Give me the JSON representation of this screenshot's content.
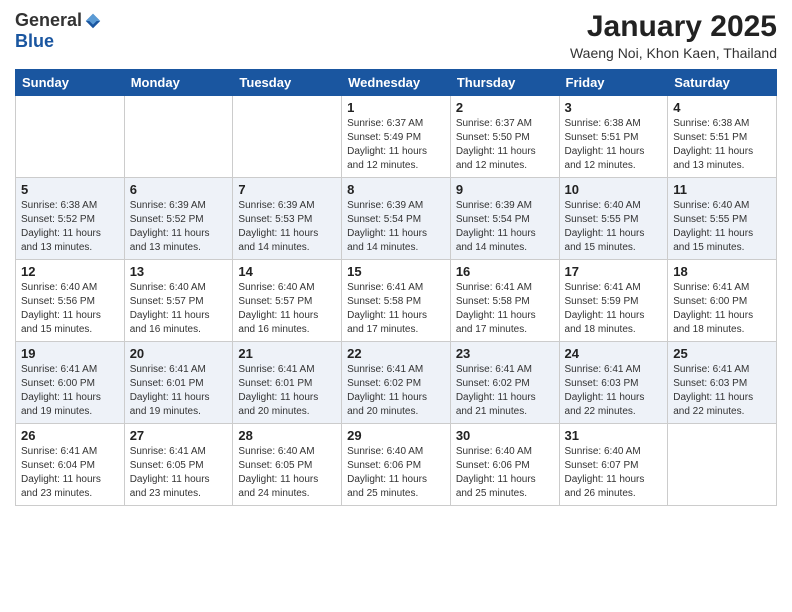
{
  "logo": {
    "general": "General",
    "blue": "Blue"
  },
  "header": {
    "month": "January 2025",
    "location": "Waeng Noi, Khon Kaen, Thailand"
  },
  "weekdays": [
    "Sunday",
    "Monday",
    "Tuesday",
    "Wednesday",
    "Thursday",
    "Friday",
    "Saturday"
  ],
  "weeks": [
    [
      {
        "day": "",
        "info": ""
      },
      {
        "day": "",
        "info": ""
      },
      {
        "day": "",
        "info": ""
      },
      {
        "day": "1",
        "info": "Sunrise: 6:37 AM\nSunset: 5:49 PM\nDaylight: 11 hours\nand 12 minutes."
      },
      {
        "day": "2",
        "info": "Sunrise: 6:37 AM\nSunset: 5:50 PM\nDaylight: 11 hours\nand 12 minutes."
      },
      {
        "day": "3",
        "info": "Sunrise: 6:38 AM\nSunset: 5:51 PM\nDaylight: 11 hours\nand 12 minutes."
      },
      {
        "day": "4",
        "info": "Sunrise: 6:38 AM\nSunset: 5:51 PM\nDaylight: 11 hours\nand 13 minutes."
      }
    ],
    [
      {
        "day": "5",
        "info": "Sunrise: 6:38 AM\nSunset: 5:52 PM\nDaylight: 11 hours\nand 13 minutes."
      },
      {
        "day": "6",
        "info": "Sunrise: 6:39 AM\nSunset: 5:52 PM\nDaylight: 11 hours\nand 13 minutes."
      },
      {
        "day": "7",
        "info": "Sunrise: 6:39 AM\nSunset: 5:53 PM\nDaylight: 11 hours\nand 14 minutes."
      },
      {
        "day": "8",
        "info": "Sunrise: 6:39 AM\nSunset: 5:54 PM\nDaylight: 11 hours\nand 14 minutes."
      },
      {
        "day": "9",
        "info": "Sunrise: 6:39 AM\nSunset: 5:54 PM\nDaylight: 11 hours\nand 14 minutes."
      },
      {
        "day": "10",
        "info": "Sunrise: 6:40 AM\nSunset: 5:55 PM\nDaylight: 11 hours\nand 15 minutes."
      },
      {
        "day": "11",
        "info": "Sunrise: 6:40 AM\nSunset: 5:55 PM\nDaylight: 11 hours\nand 15 minutes."
      }
    ],
    [
      {
        "day": "12",
        "info": "Sunrise: 6:40 AM\nSunset: 5:56 PM\nDaylight: 11 hours\nand 15 minutes."
      },
      {
        "day": "13",
        "info": "Sunrise: 6:40 AM\nSunset: 5:57 PM\nDaylight: 11 hours\nand 16 minutes."
      },
      {
        "day": "14",
        "info": "Sunrise: 6:40 AM\nSunset: 5:57 PM\nDaylight: 11 hours\nand 16 minutes."
      },
      {
        "day": "15",
        "info": "Sunrise: 6:41 AM\nSunset: 5:58 PM\nDaylight: 11 hours\nand 17 minutes."
      },
      {
        "day": "16",
        "info": "Sunrise: 6:41 AM\nSunset: 5:58 PM\nDaylight: 11 hours\nand 17 minutes."
      },
      {
        "day": "17",
        "info": "Sunrise: 6:41 AM\nSunset: 5:59 PM\nDaylight: 11 hours\nand 18 minutes."
      },
      {
        "day": "18",
        "info": "Sunrise: 6:41 AM\nSunset: 6:00 PM\nDaylight: 11 hours\nand 18 minutes."
      }
    ],
    [
      {
        "day": "19",
        "info": "Sunrise: 6:41 AM\nSunset: 6:00 PM\nDaylight: 11 hours\nand 19 minutes."
      },
      {
        "day": "20",
        "info": "Sunrise: 6:41 AM\nSunset: 6:01 PM\nDaylight: 11 hours\nand 19 minutes."
      },
      {
        "day": "21",
        "info": "Sunrise: 6:41 AM\nSunset: 6:01 PM\nDaylight: 11 hours\nand 20 minutes."
      },
      {
        "day": "22",
        "info": "Sunrise: 6:41 AM\nSunset: 6:02 PM\nDaylight: 11 hours\nand 20 minutes."
      },
      {
        "day": "23",
        "info": "Sunrise: 6:41 AM\nSunset: 6:02 PM\nDaylight: 11 hours\nand 21 minutes."
      },
      {
        "day": "24",
        "info": "Sunrise: 6:41 AM\nSunset: 6:03 PM\nDaylight: 11 hours\nand 22 minutes."
      },
      {
        "day": "25",
        "info": "Sunrise: 6:41 AM\nSunset: 6:03 PM\nDaylight: 11 hours\nand 22 minutes."
      }
    ],
    [
      {
        "day": "26",
        "info": "Sunrise: 6:41 AM\nSunset: 6:04 PM\nDaylight: 11 hours\nand 23 minutes."
      },
      {
        "day": "27",
        "info": "Sunrise: 6:41 AM\nSunset: 6:05 PM\nDaylight: 11 hours\nand 23 minutes."
      },
      {
        "day": "28",
        "info": "Sunrise: 6:40 AM\nSunset: 6:05 PM\nDaylight: 11 hours\nand 24 minutes."
      },
      {
        "day": "29",
        "info": "Sunrise: 6:40 AM\nSunset: 6:06 PM\nDaylight: 11 hours\nand 25 minutes."
      },
      {
        "day": "30",
        "info": "Sunrise: 6:40 AM\nSunset: 6:06 PM\nDaylight: 11 hours\nand 25 minutes."
      },
      {
        "day": "31",
        "info": "Sunrise: 6:40 AM\nSunset: 6:07 PM\nDaylight: 11 hours\nand 26 minutes."
      },
      {
        "day": "",
        "info": ""
      }
    ]
  ]
}
